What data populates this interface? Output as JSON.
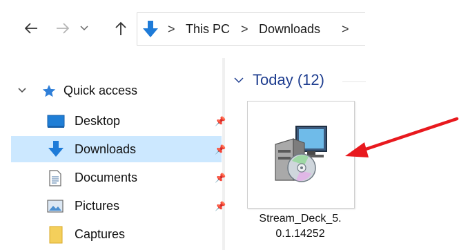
{
  "nav": {
    "back": "back-arrow",
    "forward": "forward-arrow",
    "recent": "recent-locations-chevron",
    "up": "up-arrow"
  },
  "address": {
    "crumbs": [
      "This PC",
      "Downloads"
    ],
    "separator": ">"
  },
  "sidebar": {
    "quick_access": "Quick access",
    "items": [
      {
        "label": "Desktop",
        "icon": "desktop-icon",
        "pinned": true
      },
      {
        "label": "Downloads",
        "icon": "downloads-icon",
        "pinned": true,
        "selected": true
      },
      {
        "label": "Documents",
        "icon": "documents-icon",
        "pinned": true
      },
      {
        "label": "Pictures",
        "icon": "pictures-icon",
        "pinned": true
      },
      {
        "label": "Captures",
        "icon": "folder-icon",
        "pinned": false
      }
    ],
    "selected_color": "#cce8ff"
  },
  "content": {
    "group_header": "Today (12)",
    "files": [
      {
        "name": "Stream_Deck_5.0.1.14252",
        "name_line1": "Stream_Deck_5.",
        "name_line2": "0.1.14252",
        "icon": "installer-icon"
      }
    ]
  },
  "annotation": {
    "color": "#e8191e"
  }
}
